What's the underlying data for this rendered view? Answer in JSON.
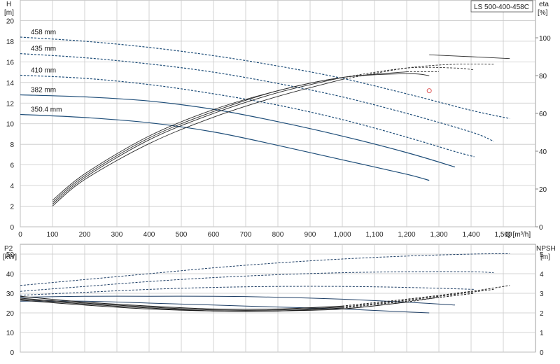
{
  "title": "LS 500-400-458C",
  "colors": {
    "head": "#1f4e79",
    "eff": "#2b2b2b",
    "power": "#1f3f66",
    "npsh": "#1a1a1a",
    "grid": "#c8c8c8",
    "marker": "#e05a5a"
  },
  "top_axes": {
    "left_label_1": "H",
    "left_label_2": "[m]",
    "right_label_1": "eta",
    "right_label_2": "[%]",
    "x_label": "Q [m³/h]",
    "x_ticks": [
      "0",
      "100",
      "200",
      "300",
      "400",
      "500",
      "600",
      "700",
      "800",
      "900",
      "1,000",
      "1,100",
      "1,200",
      "1,300",
      "1,400",
      "1,500"
    ],
    "y_ticks": [
      "0",
      "2",
      "4",
      "6",
      "8",
      "10",
      "12",
      "14",
      "16",
      "18",
      "20"
    ],
    "eta_ticks": [
      "0",
      "20",
      "40",
      "60",
      "80",
      "100"
    ]
  },
  "bottom_axes": {
    "left_label_1": "P2",
    "left_label_2": "[kW]",
    "right_label_1": "NPSH",
    "right_label_2": "[m]",
    "p2_ticks": [
      "0",
      "10",
      "20",
      "30",
      "40",
      "50"
    ],
    "npsh_ticks": [
      "0",
      "1",
      "2",
      "3",
      "4",
      "5"
    ]
  },
  "chart_data": [
    {
      "type": "line",
      "panel": "head-efficiency",
      "title": "LS 500-400-458C",
      "xlabel": "Q [m³/h]",
      "ylabel": "H [m]",
      "y2label": "eta [%]",
      "xlim": [
        0,
        1600
      ],
      "ylim": [
        0,
        22
      ],
      "y2lim": [
        0,
        120
      ],
      "head_series": [
        {
          "name": "458 mm",
          "solid_to": 0,
          "points": [
            [
              0,
              18.4
            ],
            [
              200,
              18.0
            ],
            [
              400,
              17.4
            ],
            [
              600,
              16.6
            ],
            [
              800,
              15.6
            ],
            [
              1000,
              14.4
            ],
            [
              1200,
              12.9
            ],
            [
              1400,
              11.3
            ],
            [
              1520,
              10.5
            ]
          ]
        },
        {
          "name": "435 mm",
          "solid_to": 0,
          "points": [
            [
              0,
              16.8
            ],
            [
              200,
              16.4
            ],
            [
              400,
              15.8
            ],
            [
              600,
              15.0
            ],
            [
              800,
              13.9
            ],
            [
              1000,
              12.6
            ],
            [
              1200,
              11.0
            ],
            [
              1400,
              9.2
            ],
            [
              1470,
              8.3
            ]
          ]
        },
        {
          "name": "410 mm",
          "solid_to": 100,
          "points": [
            [
              0,
              14.7
            ],
            [
              200,
              14.4
            ],
            [
              400,
              13.8
            ],
            [
              600,
              12.9
            ],
            [
              800,
              11.8
            ],
            [
              1000,
              10.4
            ],
            [
              1200,
              8.7
            ],
            [
              1350,
              7.3
            ],
            [
              1410,
              6.8
            ]
          ]
        },
        {
          "name": "382 mm",
          "solid_to": 1350,
          "points": [
            [
              0,
              12.8
            ],
            [
              200,
              12.6
            ],
            [
              400,
              12.2
            ],
            [
              600,
              11.4
            ],
            [
              800,
              10.2
            ],
            [
              1000,
              8.8
            ],
            [
              1200,
              7.2
            ],
            [
              1350,
              5.8
            ]
          ]
        },
        {
          "name": "350.4 mm",
          "solid_to": 1270,
          "points": [
            [
              0,
              10.9
            ],
            [
              200,
              10.6
            ],
            [
              400,
              10.1
            ],
            [
              600,
              9.2
            ],
            [
              800,
              7.9
            ],
            [
              1000,
              6.5
            ],
            [
              1200,
              5.1
            ],
            [
              1270,
              4.5
            ]
          ]
        }
      ],
      "efficiency_series": [
        {
          "name": "",
          "solid_to": 1100,
          "points": [
            [
              100,
              11
            ],
            [
              200,
              25
            ],
            [
              400,
              44
            ],
            [
              600,
              58
            ],
            [
              800,
              69
            ],
            [
              1000,
              78
            ],
            [
              1200,
              84
            ],
            [
              1350,
              86
            ],
            [
              1470,
              86
            ]
          ]
        },
        {
          "name": "",
          "solid_to": 1150,
          "points": [
            [
              100,
              12
            ],
            [
              200,
              26
            ],
            [
              400,
              46
            ],
            [
              600,
              60
            ],
            [
              800,
              71
            ],
            [
              1000,
              79
            ],
            [
              1200,
              84
            ],
            [
              1350,
              84
            ],
            [
              1410,
              83
            ]
          ]
        },
        {
          "name": "",
          "solid_to": 1200,
          "points": [
            [
              100,
              13
            ],
            [
              200,
              27
            ],
            [
              400,
              47
            ],
            [
              600,
              61
            ],
            [
              800,
              72
            ],
            [
              1000,
              79
            ],
            [
              1200,
              82
            ],
            [
              1300,
              82
            ]
          ]
        },
        {
          "name": "",
          "solid_to": 1270,
          "points": [
            [
              100,
              14
            ],
            [
              200,
              28
            ],
            [
              400,
              48
            ],
            [
              600,
              62
            ],
            [
              800,
              72
            ],
            [
              1000,
              79
            ],
            [
              1200,
              81
            ],
            [
              1270,
              80
            ]
          ]
        },
        {
          "name": "",
          "solid_to": 1520,
          "points": [
            [
              1270,
              91
            ],
            [
              1400,
              90
            ],
            [
              1520,
              89
            ]
          ]
        }
      ],
      "marker": {
        "x": 1270,
        "y": 13.2
      }
    },
    {
      "type": "line",
      "panel": "power-npsh",
      "ylabel": "P2 [kW]",
      "y2label": "NPSH [m]",
      "xlim": [
        0,
        1600
      ],
      "ylim": [
        0,
        55
      ],
      "y2lim": [
        0,
        5.5
      ],
      "power_series": [
        {
          "name": "",
          "solid_to": 0,
          "points": [
            [
              0,
              34
            ],
            [
              200,
              37
            ],
            [
              400,
              40
            ],
            [
              600,
              43
            ],
            [
              800,
              45.5
            ],
            [
              1000,
              47.5
            ],
            [
              1200,
              49
            ],
            [
              1400,
              50
            ],
            [
              1520,
              50.2
            ]
          ]
        },
        {
          "name": "",
          "solid_to": 0,
          "points": [
            [
              0,
              31
            ],
            [
              200,
              33.5
            ],
            [
              400,
              36
            ],
            [
              600,
              38
            ],
            [
              800,
              39.5
            ],
            [
              1000,
              40.5
            ],
            [
              1200,
              41
            ],
            [
              1400,
              41
            ],
            [
              1470,
              40.5
            ]
          ]
        },
        {
          "name": "",
          "solid_to": 100,
          "points": [
            [
              0,
              29
            ],
            [
              200,
              30.5
            ],
            [
              400,
              32
            ],
            [
              600,
              33
            ],
            [
              800,
              33.5
            ],
            [
              1000,
              33.5
            ],
            [
              1200,
              33
            ],
            [
              1410,
              32
            ]
          ]
        },
        {
          "name": "",
          "solid_to": 1350,
          "points": [
            [
              0,
              28
            ],
            [
              200,
              28.5
            ],
            [
              400,
              28.5
            ],
            [
              600,
              28.5
            ],
            [
              800,
              28
            ],
            [
              1000,
              27
            ],
            [
              1200,
              25.5
            ],
            [
              1350,
              24
            ]
          ]
        },
        {
          "name": "",
          "solid_to": 1270,
          "points": [
            [
              0,
              26
            ],
            [
              200,
              26
            ],
            [
              400,
              25
            ],
            [
              600,
              24
            ],
            [
              800,
              23
            ],
            [
              1000,
              22
            ],
            [
              1200,
              20.5
            ],
            [
              1270,
              20
            ]
          ]
        }
      ],
      "npsh_series": [
        {
          "name": "",
          "solid_to": 1150,
          "points": [
            [
              0,
              2.85
            ],
            [
              200,
              2.55
            ],
            [
              400,
              2.35
            ],
            [
              600,
              2.2
            ],
            [
              800,
              2.2
            ],
            [
              1000,
              2.35
            ],
            [
              1200,
              2.7
            ],
            [
              1400,
              3.1
            ],
            [
              1520,
              3.4
            ]
          ]
        },
        {
          "name": "",
          "solid_to": 1150,
          "points": [
            [
              0,
              2.75
            ],
            [
              200,
              2.5
            ],
            [
              400,
              2.3
            ],
            [
              600,
              2.15
            ],
            [
              800,
              2.15
            ],
            [
              1000,
              2.3
            ],
            [
              1200,
              2.65
            ],
            [
              1470,
              3.2
            ]
          ]
        },
        {
          "name": "",
          "solid_to": 1150,
          "points": [
            [
              0,
              2.7
            ],
            [
              200,
              2.45
            ],
            [
              400,
              2.25
            ],
            [
              600,
              2.1
            ],
            [
              800,
              2.1
            ],
            [
              1000,
              2.25
            ],
            [
              1200,
              2.6
            ],
            [
              1410,
              3.0
            ]
          ]
        },
        {
          "name": "",
          "solid_to": 1200,
          "points": [
            [
              0,
              2.65
            ],
            [
              200,
              2.4
            ],
            [
              400,
              2.2
            ],
            [
              600,
              2.1
            ],
            [
              800,
              2.1
            ],
            [
              1000,
              2.2
            ],
            [
              1200,
              2.55
            ],
            [
              1300,
              2.8
            ]
          ]
        }
      ]
    }
  ]
}
